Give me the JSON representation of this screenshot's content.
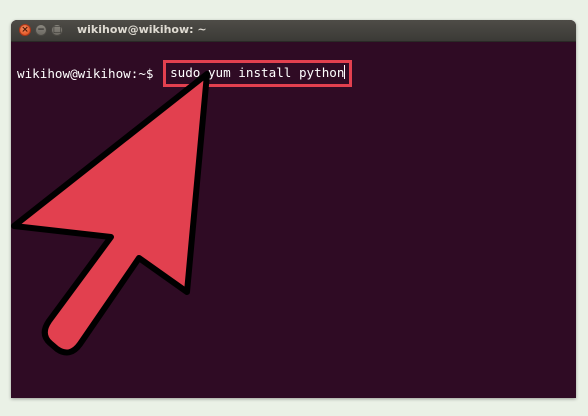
{
  "window": {
    "title": "wikihow@wikihow: ~"
  },
  "terminal": {
    "prompt": "wikihow@wikihow:~$ ",
    "command": "sudo yum install python"
  },
  "colors": {
    "terminal_bg": "#2f0b24",
    "highlight": "#e2404f",
    "arrow_fill": "#e2404f"
  },
  "icons": {
    "close": "close-icon",
    "minimize": "minimize-icon",
    "maximize": "maximize-icon",
    "annotation": "pointer-arrow-icon"
  }
}
